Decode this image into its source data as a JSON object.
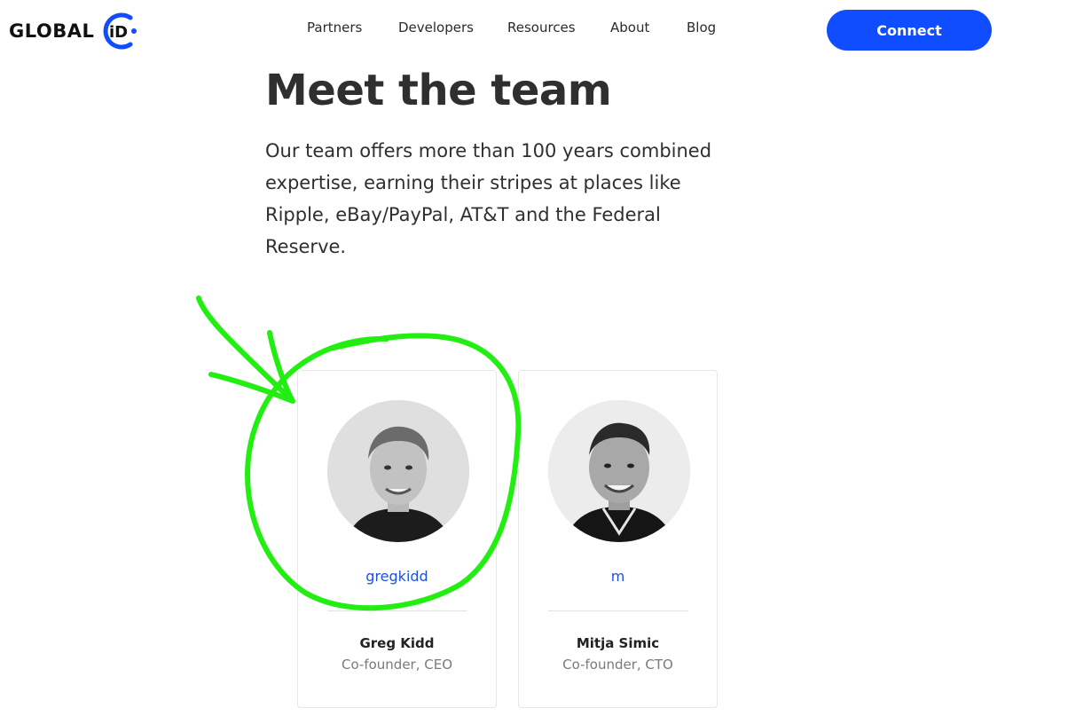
{
  "header": {
    "logo_text": "GLOBAL",
    "logo_mark_text": "iD",
    "nav": [
      {
        "label": "Partners"
      },
      {
        "label": "Developers"
      },
      {
        "label": "Resources"
      },
      {
        "label": "About"
      },
      {
        "label": "Blog"
      }
    ],
    "connect_label": "Connect"
  },
  "hero": {
    "title": "Meet the team",
    "intro": "Our team offers more than 100 years combined expertise, earning their stripes at places like Ripple, eBay/PayPal, AT&T and the Federal Reserve."
  },
  "team": [
    {
      "handle": "gregkidd",
      "name": "Greg Kidd",
      "role": "Co-founder, CEO"
    },
    {
      "handle": "m",
      "name": "Mitja Simic",
      "role": "Co-founder, CTO"
    }
  ],
  "colors": {
    "brand_blue": "#0f4dff",
    "handle_blue": "#1f4fe0",
    "annotation_green": "#22ee11"
  }
}
